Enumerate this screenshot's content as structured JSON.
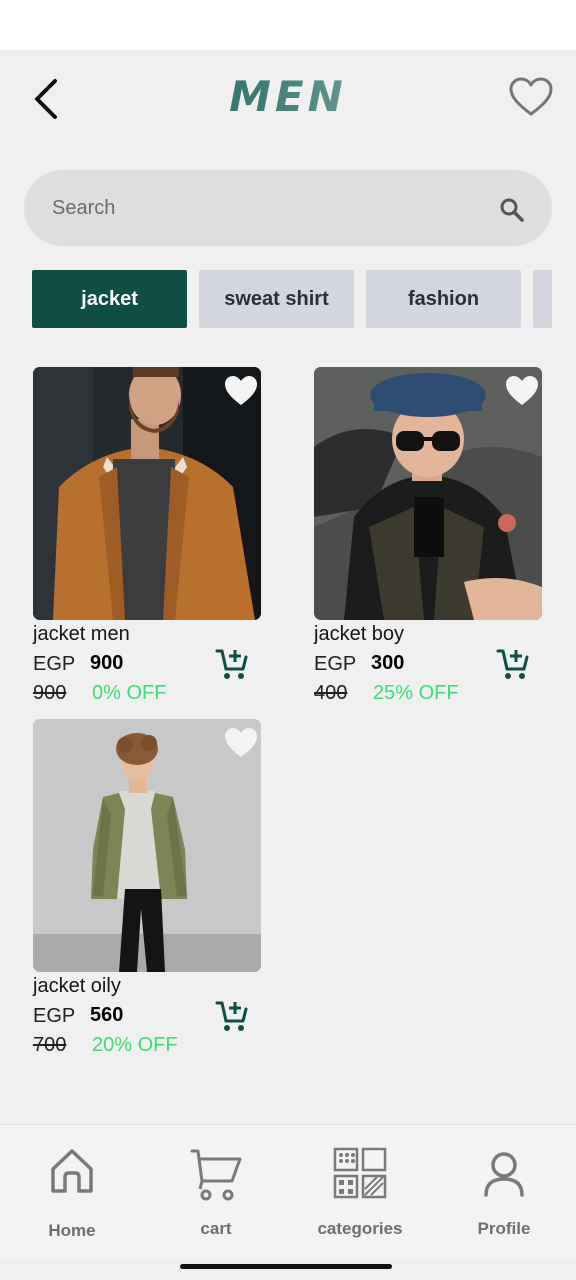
{
  "header": {
    "title": "MEN",
    "back_icon": "chevron-left-icon",
    "wishlist_icon": "heart-outline-icon"
  },
  "search": {
    "placeholder": "Search",
    "icon": "search-icon"
  },
  "categories": [
    {
      "label": "jacket",
      "active": true
    },
    {
      "label": "sweat shirt",
      "active": false
    },
    {
      "label": "fashion",
      "active": false
    }
  ],
  "products": [
    {
      "name": "jacket men",
      "currency": "EGP",
      "price": "900",
      "old_price": "900",
      "discount": "0% OFF"
    },
    {
      "name": "jacket boy",
      "currency": "EGP",
      "price": "300",
      "old_price": "400",
      "discount": "25% OFF"
    },
    {
      "name": "jacket oily",
      "currency": "EGP",
      "price": "560",
      "old_price": "700",
      "discount": "20% OFF"
    }
  ],
  "bottom_nav": [
    {
      "label": "Home",
      "icon": "home-icon"
    },
    {
      "label": "cart",
      "icon": "cart-icon"
    },
    {
      "label": "categories",
      "icon": "categories-icon"
    },
    {
      "label": "Profile",
      "icon": "profile-icon"
    }
  ],
  "colors": {
    "brand": "#0f4d45",
    "discount": "#3ddc75",
    "chip_inactive": "#d3d6de",
    "background": "#f0f0f0"
  }
}
